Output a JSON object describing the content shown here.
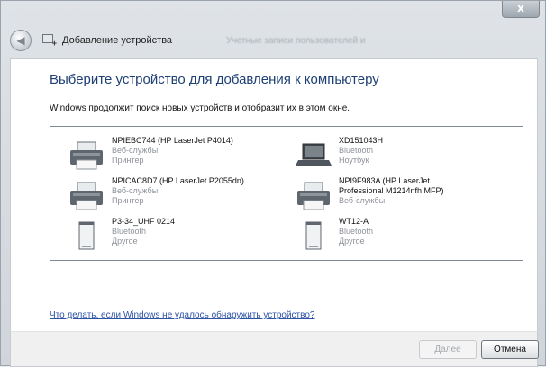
{
  "window": {
    "title": "Добавление устройства",
    "title_blurred": "Учетные записи пользователей и",
    "close_label": "x"
  },
  "main": {
    "heading": "Выберите устройство для добавления к компьютеру",
    "subtext": "Windows продолжит поиск новых устройств и отобразит их в этом окне.",
    "help_link": "Что делать, если Windows не удалось обнаружить устройство?"
  },
  "devices": [
    {
      "name": "NPIEBC744 (HP LaserJet P4014)",
      "line1": "Веб-службы",
      "line2": "Принтер",
      "icon": "printer-icon"
    },
    {
      "name": "XD151043H",
      "line1": "Bluetooth",
      "line2": "Ноутбук",
      "icon": "laptop-icon"
    },
    {
      "name": "NPICAC8D7 (HP LaserJet P2055dn)",
      "line1": "Веб-службы",
      "line2": "Принтер",
      "icon": "printer-icon"
    },
    {
      "name": "NPI9F983A (HP LaserJet",
      "name2": "Professional M1214nfh MFP)",
      "line1": "Веб-службы",
      "icon": "printer-icon"
    },
    {
      "name": "P3-34_UHF 0214",
      "line1": "Bluetooth",
      "line2": "Другое",
      "icon": "generic-device-icon"
    },
    {
      "name": "WT12-A",
      "line1": "Bluetooth",
      "line2": "Другое",
      "icon": "generic-device-icon"
    }
  ],
  "footer": {
    "next_label": "Далее",
    "cancel_label": "Отмена"
  }
}
